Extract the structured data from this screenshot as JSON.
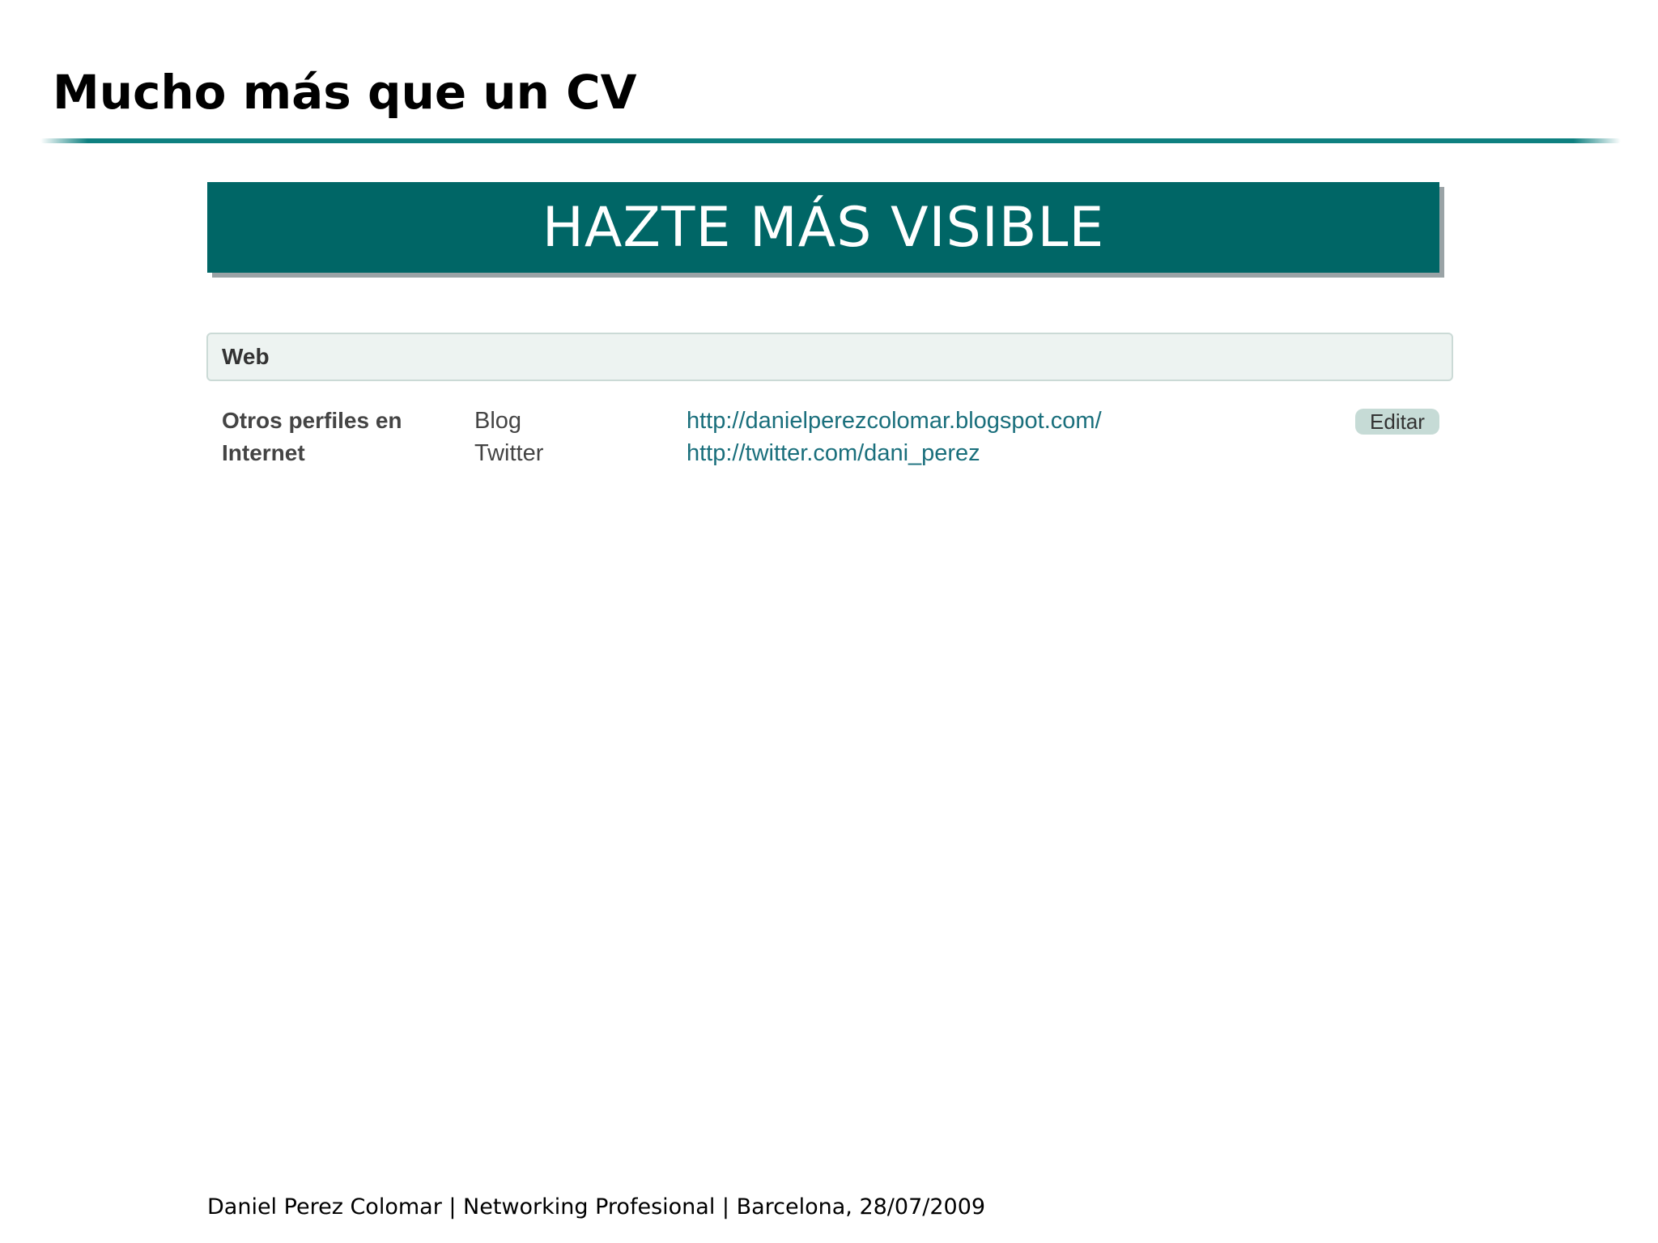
{
  "slide": {
    "title": "Mucho más que un CV"
  },
  "banner": {
    "text": "HAZTE MÁS VISIBLE",
    "background_color": "#006666"
  },
  "web_section": {
    "title": "Web",
    "label_line1": "Otros perfiles en",
    "label_line2": "Internet",
    "profiles": [
      {
        "type": "Blog",
        "url": "http://danielperezcolomar.blogspot.com/"
      },
      {
        "type": "Twitter",
        "url": "http://twitter.com/dani_perez"
      }
    ],
    "edit_label": "Editar"
  },
  "footer": {
    "text": "Daniel Perez Colomar | Networking Profesional | Barcelona, 28/07/2009"
  },
  "colors": {
    "accent": "#0e8080",
    "link": "#1a6f7c",
    "panel_background": "#edf3f1"
  }
}
